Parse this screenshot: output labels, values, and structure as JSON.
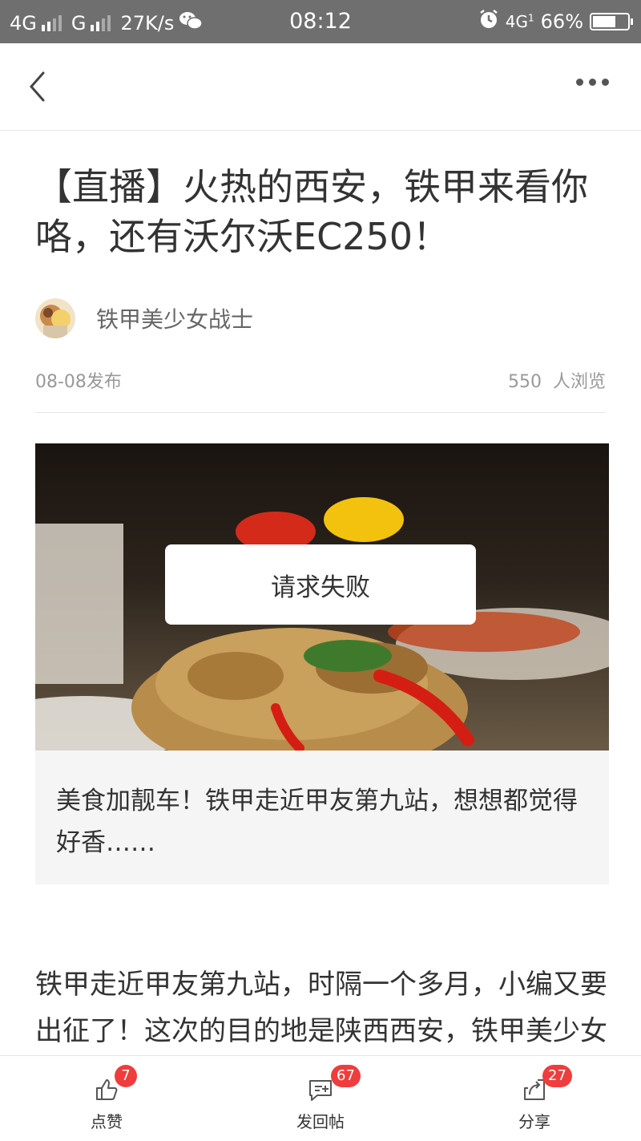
{
  "status_bar": {
    "network1": "4G",
    "network2": "G",
    "speed": "27K/s",
    "time": "08:12",
    "network3": "4G",
    "network3_sub": "1",
    "battery": "66%",
    "battery_level": 0.66,
    "icons": [
      "signal-icon",
      "wechat-icon",
      "alarm-icon",
      "battery-icon"
    ]
  },
  "nav": {
    "back_icon": "chevron-left-icon",
    "more_icon": "more-dots-icon"
  },
  "article": {
    "title": "【直播】火热的西安，铁甲来看你咯，还有沃尔沃EC250！",
    "author": "铁甲美少女战士",
    "published": "08-08发布",
    "views": "550  人浏览",
    "card": {
      "error": "请求失败",
      "text": "美食加靓车！铁甲走近甲友第九站，想想都觉得好香……"
    },
    "body": "铁甲走近甲友第九站，时隔一个多月，小编又要出征了！这次的目的地是陕西西安，铁甲美少女战士们带着满满的诚意"
  },
  "bottom_bar": {
    "like": {
      "label": "点赞",
      "count": "7",
      "icon": "thumbs-up-icon"
    },
    "reply": {
      "label": "发回帖",
      "count": "67",
      "icon": "comment-add-icon"
    },
    "share": {
      "label": "分享",
      "count": "27",
      "icon": "share-icon"
    }
  },
  "colors": {
    "status_bar_bg": "#6f6f6f",
    "badge": "#ef3d3d",
    "card_bg": "#f5f5f5"
  }
}
